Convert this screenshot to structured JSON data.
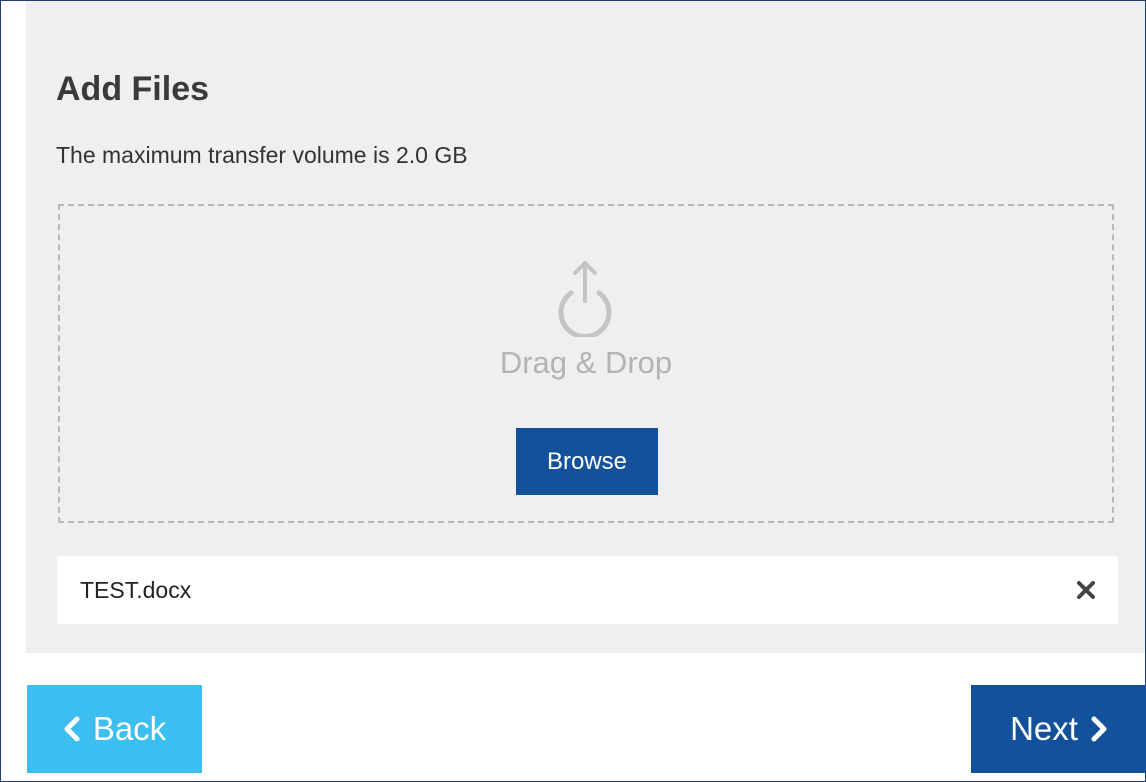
{
  "page": {
    "title": "Add Files",
    "subtitle": "The maximum transfer volume is 2.0 GB"
  },
  "dropzone": {
    "icon": "upload-power-icon",
    "label": "Drag & Drop",
    "browse_label": "Browse"
  },
  "files": [
    {
      "name": "TEST.docx",
      "remove_icon": "close-icon"
    }
  ],
  "nav": {
    "back_label": "Back",
    "next_label": "Next"
  },
  "colors": {
    "primary": "#13529a",
    "back_button": "#3cbff0",
    "panel_bg": "#efefef",
    "dropzone_border": "#b8b8b8",
    "muted_text": "#b3b3b3"
  }
}
